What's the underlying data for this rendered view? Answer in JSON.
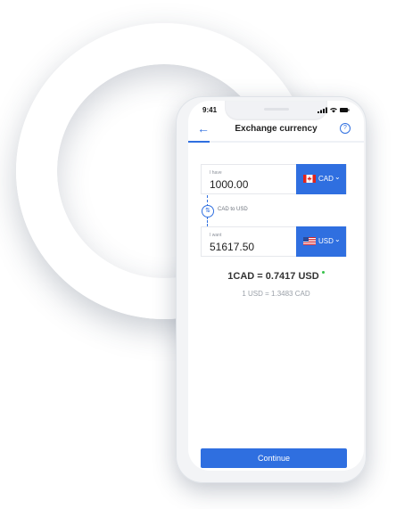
{
  "status_bar": {
    "time": "9:41"
  },
  "header": {
    "title": "Exchange currency",
    "back_icon": "arrow-left-icon",
    "help_icon": "question-circle-icon",
    "help_glyph": "?"
  },
  "progress": {
    "fraction": 0.12
  },
  "have": {
    "label": "I have",
    "value": "1000.00",
    "currency": "CAD",
    "flag": "canada-flag-icon"
  },
  "swap": {
    "icon": "swap-arrows-icon",
    "glyph": "⇅",
    "pair_label": "CAD to USD"
  },
  "want": {
    "label": "I want",
    "value": "51617.50",
    "currency": "USD",
    "flag": "usa-flag-icon"
  },
  "rate": {
    "main": "1CAD = 0.7417 USD",
    "inverse": "1 USD = 1.3483 CAD"
  },
  "continue_label": "Continue",
  "colors": {
    "accent": "#2f6fe0",
    "live": "#36c24a"
  }
}
